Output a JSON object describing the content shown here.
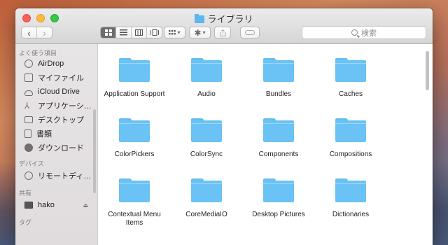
{
  "window": {
    "title": "ライブラリ"
  },
  "toolbar": {
    "nav_back": "‹",
    "nav_forward": "›",
    "view_modes": [
      "icon",
      "list",
      "column",
      "coverflow"
    ],
    "arrange_label": "▾",
    "action_label": "▾",
    "search_placeholder": "検索"
  },
  "sidebar": {
    "favorites_heading": "よく使う項目",
    "favorites": [
      {
        "label": "AirDrop",
        "icon": "airdrop-icon"
      },
      {
        "label": "マイファイル",
        "icon": "allfiles-icon"
      },
      {
        "label": "iCloud Drive",
        "icon": "cloud-icon"
      },
      {
        "label": "アプリケーシ…",
        "icon": "applications-icon"
      },
      {
        "label": "デスクトップ",
        "icon": "desktop-icon"
      },
      {
        "label": "書類",
        "icon": "documents-icon"
      },
      {
        "label": "ダウンロード",
        "icon": "downloads-icon"
      }
    ],
    "devices_heading": "デバイス",
    "devices": [
      {
        "label": "リモートディ…",
        "icon": "disc-icon"
      }
    ],
    "shared_heading": "共有",
    "shared": [
      {
        "label": "hako",
        "icon": "computer-icon",
        "eject": "⏏"
      }
    ],
    "tags_heading": "タグ"
  },
  "folders": [
    "Application Support",
    "Audio",
    "Bundles",
    "Caches",
    "ColorPickers",
    "ColorSync",
    "Components",
    "Compositions",
    "Contextual Menu Items",
    "CoreMediaIO",
    "Desktop Pictures",
    "Dictionaries"
  ],
  "colors": {
    "folder": "#6ac2f5",
    "close": "#fc605c",
    "minimize": "#fdbc40",
    "maximize": "#34c84a"
  }
}
